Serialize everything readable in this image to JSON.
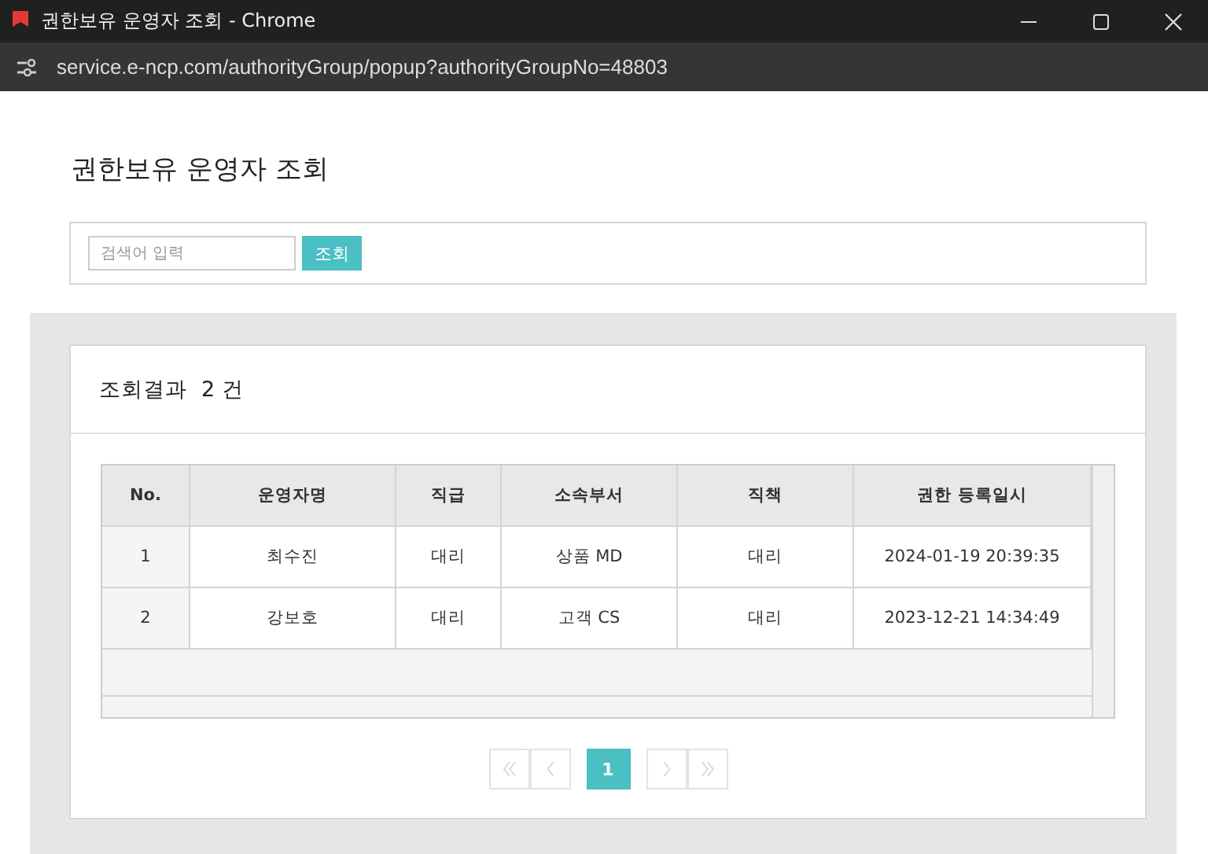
{
  "window": {
    "title": "권한보유 운영자 조회 - Chrome",
    "url": "service.e-ncp.com/authorityGroup/popup?authorityGroupNo=48803"
  },
  "page_title": "권한보유 운영자 조회",
  "search": {
    "placeholder": "검색어 입력",
    "button": "조회"
  },
  "result": {
    "label": "조회결과",
    "count": "2",
    "unit": "건"
  },
  "table": {
    "columns": [
      "No.",
      "운영자명",
      "직급",
      "소속부서",
      "직책",
      "권한 등록일시"
    ],
    "rows": [
      [
        "1",
        "최수진",
        "대리",
        "상품 MD",
        "대리",
        "2024-01-19 20:39:35"
      ],
      [
        "2",
        "강보호",
        "대리",
        "고객 CS",
        "대리",
        "2023-12-21 14:34:49"
      ]
    ]
  },
  "pagination": {
    "before": [
      {
        "kind": "first",
        "disabled": true
      },
      {
        "kind": "prev",
        "disabled": true
      }
    ],
    "pages": [
      {
        "label": "1",
        "selected": true
      }
    ],
    "after": [
      {
        "kind": "next",
        "disabled": true
      },
      {
        "kind": "last",
        "disabled": true
      }
    ]
  }
}
